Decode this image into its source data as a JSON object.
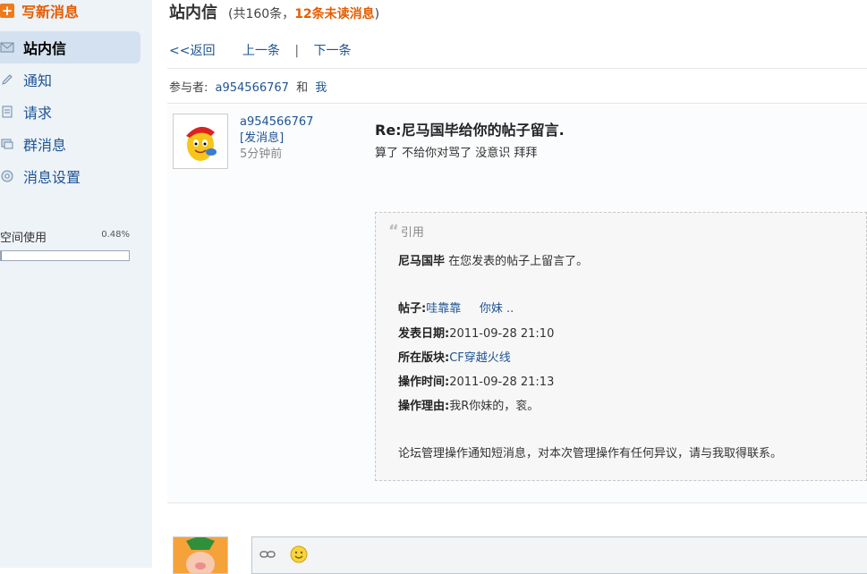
{
  "sidebar": {
    "compose_label": "写新消息",
    "items": [
      {
        "label": "站内信",
        "icon": "envelope-icon",
        "active": true
      },
      {
        "label": "通知",
        "icon": "pencil-icon"
      },
      {
        "label": "请求",
        "icon": "document-icon"
      },
      {
        "label": "群消息",
        "icon": "group-icon"
      },
      {
        "label": "消息设置",
        "icon": "settings-icon"
      }
    ],
    "storage": {
      "label": "空间使用",
      "percent": "0.48%",
      "value": 0.48
    }
  },
  "header": {
    "title": "站内信",
    "counts_prefix": "(共160条，",
    "unread": "12条未读消息",
    "counts_suffix": ")"
  },
  "pager": {
    "back": "<<返回",
    "prev": "上一条",
    "sep": "|",
    "next": "下一条"
  },
  "participants": {
    "label": "参与者:",
    "user": "a954566767",
    "and": "和",
    "me": "我"
  },
  "message": {
    "sender": "a954566767",
    "send_msg": "[发消息]",
    "time": "5分钟前",
    "subject": "Re:尼马国毕给你的帖子留言.",
    "body": "算了 不给你对骂了  没意识  拜拜"
  },
  "quote": {
    "label": "引用",
    "intro_name": "尼马国毕",
    "intro_text": "在您发表的帖子上留言了。",
    "post_label": "帖子:",
    "post_title": "哇靠靠     你妹 ..",
    "date_label": "发表日期:",
    "date_value": "2011-09-28 21:10",
    "board_label": "所在版块:",
    "board_value": "CF穿越火线",
    "op_time_label": "操作时间:",
    "op_time_value": "2011-09-28 21:13",
    "reason_label": "操作理由:",
    "reason_value": "我R你妹的，衮。",
    "footer": "论坛管理操作通知短消息，对本次管理操作有任何异议，请与我取得联系。"
  },
  "colors": {
    "accent": "#e55c00",
    "link": "#1e5494",
    "sidebar_bg": "#eef3f8",
    "active_bg": "#d4e1f0"
  }
}
